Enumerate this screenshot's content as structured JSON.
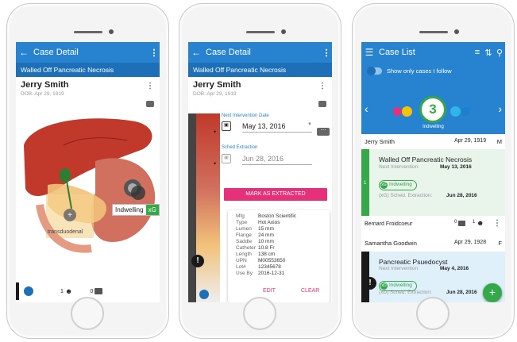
{
  "phone1": {
    "title": "Case Detail",
    "subtitle": "Walled Off Pancreatic Necrosis",
    "patient": "Jerry Smith",
    "dob": "DOB: Apr 29, 1919",
    "stent_label": "Indwelling",
    "stent_badge": "xG",
    "transduodenal": "transduodenal",
    "followers": "1",
    "comments": "0"
  },
  "phone2": {
    "title": "Case Detail",
    "subtitle": "Walled Off Pancreatic Necrosis",
    "patient": "Jerry Smith",
    "dob": "DOB: Apr 29, 1919",
    "next_label": "Next Intervention Date",
    "next_date": "May 13, 2016",
    "sched_label": "Sched Extraction",
    "sched_date": "Jun 28, 2016",
    "mark_button": "MARK AS EXTRACTED",
    "specs": [
      {
        "k": "Mfg",
        "v": "Boston Scientific"
      },
      {
        "k": "Type",
        "v": "Hot Axios"
      },
      {
        "k": "Lumen",
        "v": "15 mm"
      },
      {
        "k": "Flange",
        "v": "24 mm"
      },
      {
        "k": "Saddle",
        "v": "10 mm"
      },
      {
        "k": "Catheter",
        "v": "10.8 Fr"
      },
      {
        "k": "Length",
        "v": "138 cm"
      },
      {
        "k": "UPN",
        "v": "M00553650"
      },
      {
        "k": "Lot#",
        "v": "12345678"
      },
      {
        "k": "Use By",
        "v": "2016-12-31"
      }
    ],
    "edit": "EDIT",
    "clear": "CLEAR",
    "alert": "!"
  },
  "phone3": {
    "title": "Case List",
    "follow_label": "Show only cases I follow",
    "count": "3",
    "count_label": "Indwelling",
    "case1": {
      "patient": "Jerry Smith",
      "date": "Apr 29, 1919",
      "sex": "M",
      "diagnosis": "Walled Off Pancreatic Necrosis",
      "next_label": "Next Intervention:",
      "next_date": "May 13, 2016",
      "status": "Indwelling",
      "sched_label": "(xG)  Sched. Extraction:",
      "sched_date": "Jun 28, 2016",
      "row_num": "1",
      "physician": "Bernard Froidcoeur",
      "comments": "0",
      "followers": "1"
    },
    "case2": {
      "patient": "Samantha Goodwin",
      "date": "Apr 29, 1928",
      "sex": "F",
      "diagnosis": "Pancreatic Psuedocyst",
      "next_label": "Next Intervention:",
      "next_date": "May 4, 2016",
      "status": "Indwelling",
      "sched_label": "(xD)  Sched. Extraction:",
      "sched_date": "Jun 28, 2016"
    },
    "fab": "+"
  },
  "colors": {
    "appbar": "#2783d0",
    "subbar": "#1d6fb8",
    "accent_pink": "#e6307a",
    "status_green": "#35a84a",
    "dot1": "#e6307a",
    "dot2": "#f5c400",
    "dot3": "#2fb5e8",
    "dot4": "#1d7fd0"
  }
}
